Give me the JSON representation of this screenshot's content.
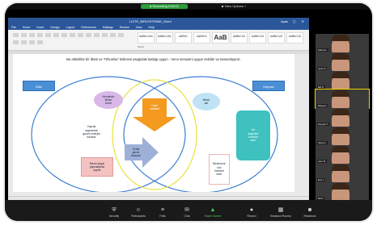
{
  "meeting": {
    "recording_label": "● Recording  0:54:11",
    "view_options": "■ View Options ˅"
  },
  "word": {
    "title": "LISTE_BIRLESTIRME_Word",
    "user": "Ayse",
    "tabs": [
      "File",
      "Home",
      "Insert",
      "Design",
      "Layout",
      "References",
      "Mailings",
      "Review",
      "View",
      "Help"
    ],
    "styles": [
      "AaBbCcDc",
      "AaBbCcDc",
      "AaBbC",
      "AaBbCc",
      "AaB",
      "AaBbCcD",
      "AaBbCcD",
      "AaBbCcD",
      "AaBbCcD",
      "AaBbCcD"
    ],
    "styles_label": "Styles",
    "heading": "Bu etkinlikte bir ilkesi ve 'Tohumlar' kelimesi asagidaki taslagi uygun - Venn semasini uygun sekilde ve tamamlayiniz.",
    "diagram": {
      "left_title": "Bitki",
      "right_title": "Hayvan",
      "left_top": "Kendinde\nBesin\nUretir",
      "left_mid": "Yaprak\nsayesinde\ngunes enerjisi\nkullanir",
      "left_bot": "Besin kaydi\nyapraklarda\nyapilir",
      "center_top": "Canli\nvarliklar",
      "center_arrow": "Ortak\ngerek\nduyulan",
      "right_top": "Besin\nalir",
      "right_mid": "Yer\ndegistirir\nhareket\neder",
      "right_bot": "Beslenme\nicin\nhareket\neder"
    }
  },
  "participants": [
    {
      "name": "Zehra K."
    },
    {
      "name": "Ayse D."
    },
    {
      "name": "Elif S."
    },
    {
      "name": "Meryem"
    },
    {
      "name": "Zeynep T."
    },
    {
      "name": "Sena A."
    },
    {
      "name": "Irem B."
    },
    {
      "name": "Ece Y."
    },
    {
      "name": "Nil K."
    }
  ],
  "controls": [
    {
      "label": "Security",
      "icon": "⛨"
    },
    {
      "label": "Participants",
      "icon": "☺"
    },
    {
      "label": "Polls",
      "icon": "≡"
    },
    {
      "label": "Chat",
      "icon": "✉"
    },
    {
      "label": "Share Screen",
      "icon": "▲"
    },
    {
      "label": "Record",
      "icon": "●"
    },
    {
      "label": "Breakout Rooms",
      "icon": "▦"
    },
    {
      "label": "Reactions",
      "icon": "☻"
    }
  ]
}
